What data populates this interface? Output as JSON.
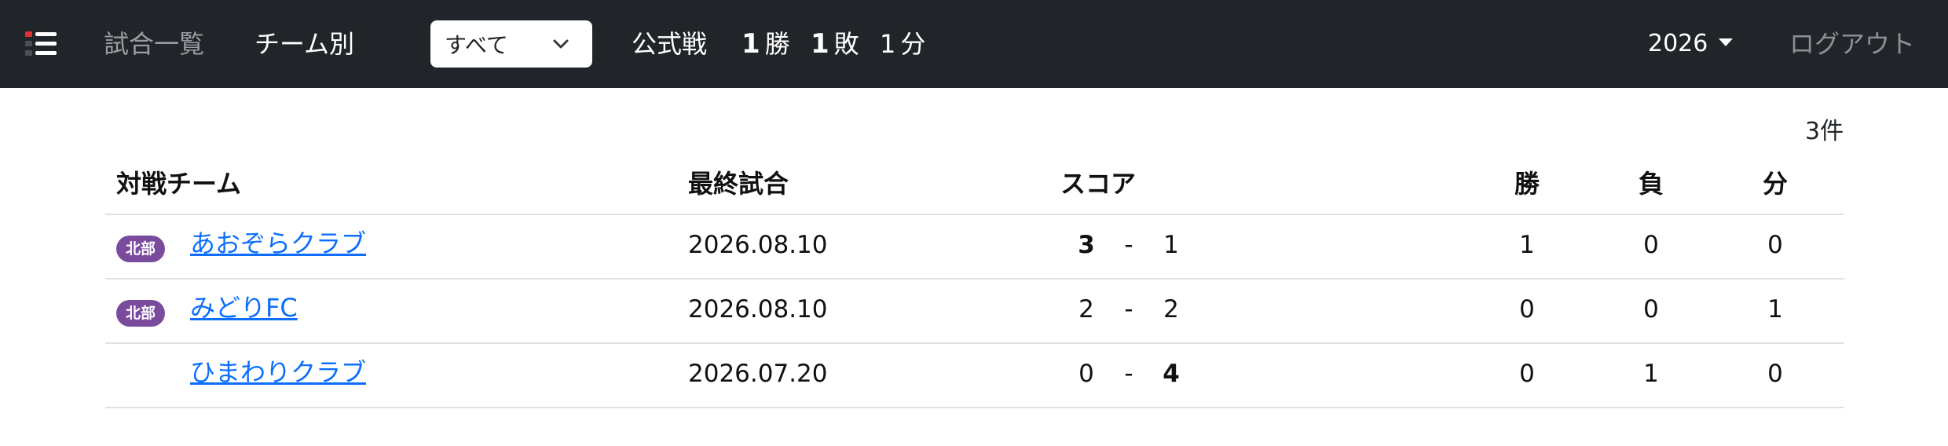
{
  "navbar": {
    "logo_icon": "list-menu-icon",
    "nav_items": [
      "試合一覧",
      "チーム別"
    ],
    "filter_selected": "すべて",
    "record": {
      "label": "公式戦",
      "wins": "1",
      "wins_unit": "勝",
      "losses": "1",
      "losses_unit": "敗",
      "draws": "1",
      "draws_unit": "分"
    },
    "year": "2026",
    "logout": "ログアウト"
  },
  "count": "3件",
  "table": {
    "headers": {
      "team": "対戦チーム",
      "last_match": "最終試合",
      "score": "スコア",
      "win": "勝",
      "loss": "負",
      "draw": "分"
    },
    "rows": [
      {
        "badge": "北部",
        "team": "あおぞらクラブ",
        "last_match": "2026.08.10",
        "score_home": "3",
        "score_sep": "-",
        "score_away": "1",
        "win": "1",
        "loss": "0",
        "draw": "0"
      },
      {
        "badge": "北部",
        "team": "みどりFC",
        "last_match": "2026.08.10",
        "score_home": "2",
        "score_sep": "-",
        "score_away": "2",
        "win": "0",
        "loss": "0",
        "draw": "1"
      },
      {
        "badge": "",
        "team": "ひまわりクラブ",
        "last_match": "2026.07.20",
        "score_home": "0",
        "score_sep": "-",
        "score_away": "4",
        "win": "0",
        "loss": "1",
        "draw": "0"
      }
    ]
  },
  "colors": {
    "navbar_bg": "#212529",
    "badge_bg": "#7a4a9c",
    "link": "#0d6efd"
  }
}
